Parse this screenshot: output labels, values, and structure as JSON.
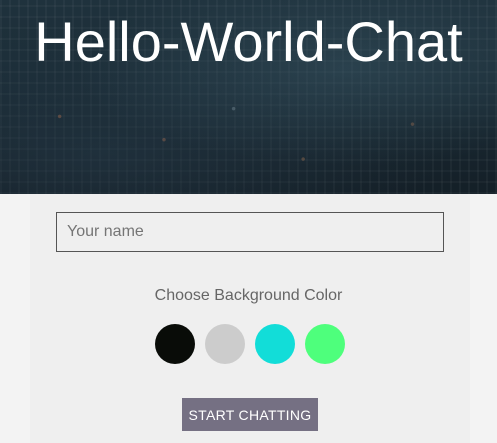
{
  "app": {
    "title": "Hello-World-Chat"
  },
  "form": {
    "name_placeholder": "Your name",
    "name_value": "",
    "color_label": "Choose Background Color",
    "colors": [
      {
        "name": "black",
        "hex": "#090C08"
      },
      {
        "name": "gray",
        "hex": "#CCCCCC"
      },
      {
        "name": "cyan",
        "hex": "#12DDD8"
      },
      {
        "name": "green",
        "hex": "#4EFF7C"
      }
    ],
    "start_label": "START CHATTING"
  },
  "theme": {
    "button_color": "#757083",
    "panel_color": "#EFEFEF"
  }
}
